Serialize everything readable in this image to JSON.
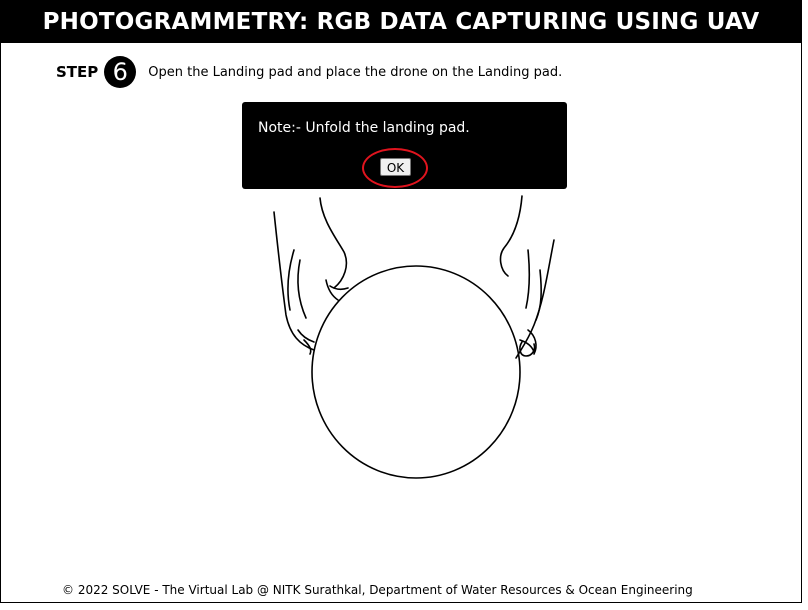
{
  "header": {
    "title": "PHOTOGRAMMETRY: RGB DATA CAPTURING USING UAV"
  },
  "step": {
    "label": "STEP",
    "number": "6",
    "instruction": "Open the Landing pad and place the drone on the Landing pad."
  },
  "note": {
    "text": "Note:- Unfold the landing pad.",
    "ok_label": "OK",
    "highlight_color": "#e0141e"
  },
  "illustration": {
    "icon": "hands-holding-landing-pad"
  },
  "footer": {
    "text": "© 2022 SOLVE - The Virtual Lab @ NITK Surathkal, Department of Water Resources & Ocean Engineering"
  }
}
